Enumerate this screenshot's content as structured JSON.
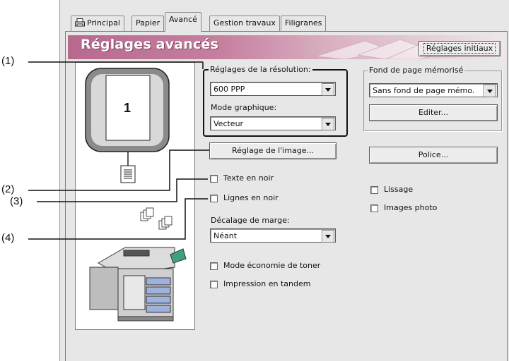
{
  "tabs": [
    "Principal",
    "Papier",
    "Avancé",
    "Gestion travaux",
    "Filigranes"
  ],
  "banner": {
    "title": "Réglages avancés",
    "reset_button": "Réglages initiaux"
  },
  "preview": {
    "page_number": "1"
  },
  "resolution": {
    "group_label": "Réglages de la résolution:",
    "value": "600 PPP",
    "graphic_mode_label": "Mode graphique:",
    "graphic_mode_value": "Vecteur"
  },
  "image_button": "Réglage de l'image...",
  "checkboxes_left": {
    "black_text": "Texte en noir",
    "black_lines": "Lignes en noir"
  },
  "margin": {
    "label": "Décalage de marge:",
    "value": "Néant"
  },
  "checkboxes_bottom": {
    "toner_save": "Mode économie de toner",
    "tandem": "Impression en tandem"
  },
  "overlay": {
    "group_label": "Fond de page mémorisé",
    "value": "Sans fond de page mémo.",
    "edit_button": "Editer..."
  },
  "font_button": "Police...",
  "checkboxes_right": {
    "smoothing": "Lissage",
    "photo": "Images photo"
  },
  "callouts": [
    "(1)",
    "(2)",
    "(3)",
    "(4)"
  ]
}
